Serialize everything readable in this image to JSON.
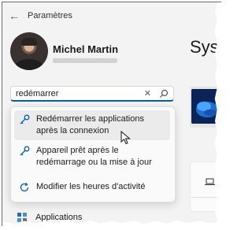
{
  "window": {
    "title": "Paramètres",
    "back_icon": "back-arrow-icon"
  },
  "user": {
    "name": "Michel Martin"
  },
  "section": {
    "title": "Syst"
  },
  "search": {
    "value": "redémarrer",
    "clear_icon": "close-icon",
    "search_icon": "search-icon"
  },
  "suggestions": [
    {
      "text": "Redémarrer les applications après la connexion",
      "icon": "key-icon",
      "highlighted": true
    },
    {
      "text": "Appareil prêt après le redémarrage ou la mise à jour",
      "icon": "key-icon",
      "highlighted": false
    },
    {
      "text": "Modifier les heures d'activité",
      "icon": "refresh-icon",
      "highlighted": false
    }
  ],
  "nav": {
    "apps_label": "Applications"
  },
  "colors": {
    "accent": "#005fb8",
    "highlight": "#ebebeb",
    "background": "#f3f3f3"
  }
}
